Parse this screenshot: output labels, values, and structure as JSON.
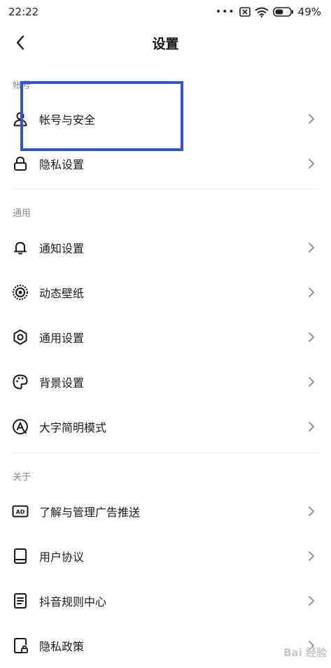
{
  "status": {
    "time": "22:22",
    "battery": "49%"
  },
  "nav": {
    "title": "设置"
  },
  "sections": [
    {
      "title": "帐号",
      "items": [
        {
          "label": "帐号与安全",
          "icon": "person-icon"
        },
        {
          "label": "隐私设置",
          "icon": "lock-icon"
        }
      ]
    },
    {
      "title": "通用",
      "items": [
        {
          "label": "通知设置",
          "icon": "bell-icon"
        },
        {
          "label": "动态壁纸",
          "icon": "live-wallpaper-icon"
        },
        {
          "label": "通用设置",
          "icon": "gear-icon"
        },
        {
          "label": "背景设置",
          "icon": "palette-icon"
        },
        {
          "label": "大字简明模式",
          "icon": "large-text-icon"
        }
      ]
    },
    {
      "title": "关于",
      "items": [
        {
          "label": "了解与管理广告推送",
          "icon": "ad-icon"
        },
        {
          "label": "用户协议",
          "icon": "book-icon"
        },
        {
          "label": "抖音规则中心",
          "icon": "document-icon"
        },
        {
          "label": "隐私政策",
          "icon": "lock-document-icon"
        }
      ]
    }
  ],
  "watermark": "Bai 经验",
  "colors": {
    "highlight": "#3153d6",
    "section": "#8a8a8a"
  }
}
